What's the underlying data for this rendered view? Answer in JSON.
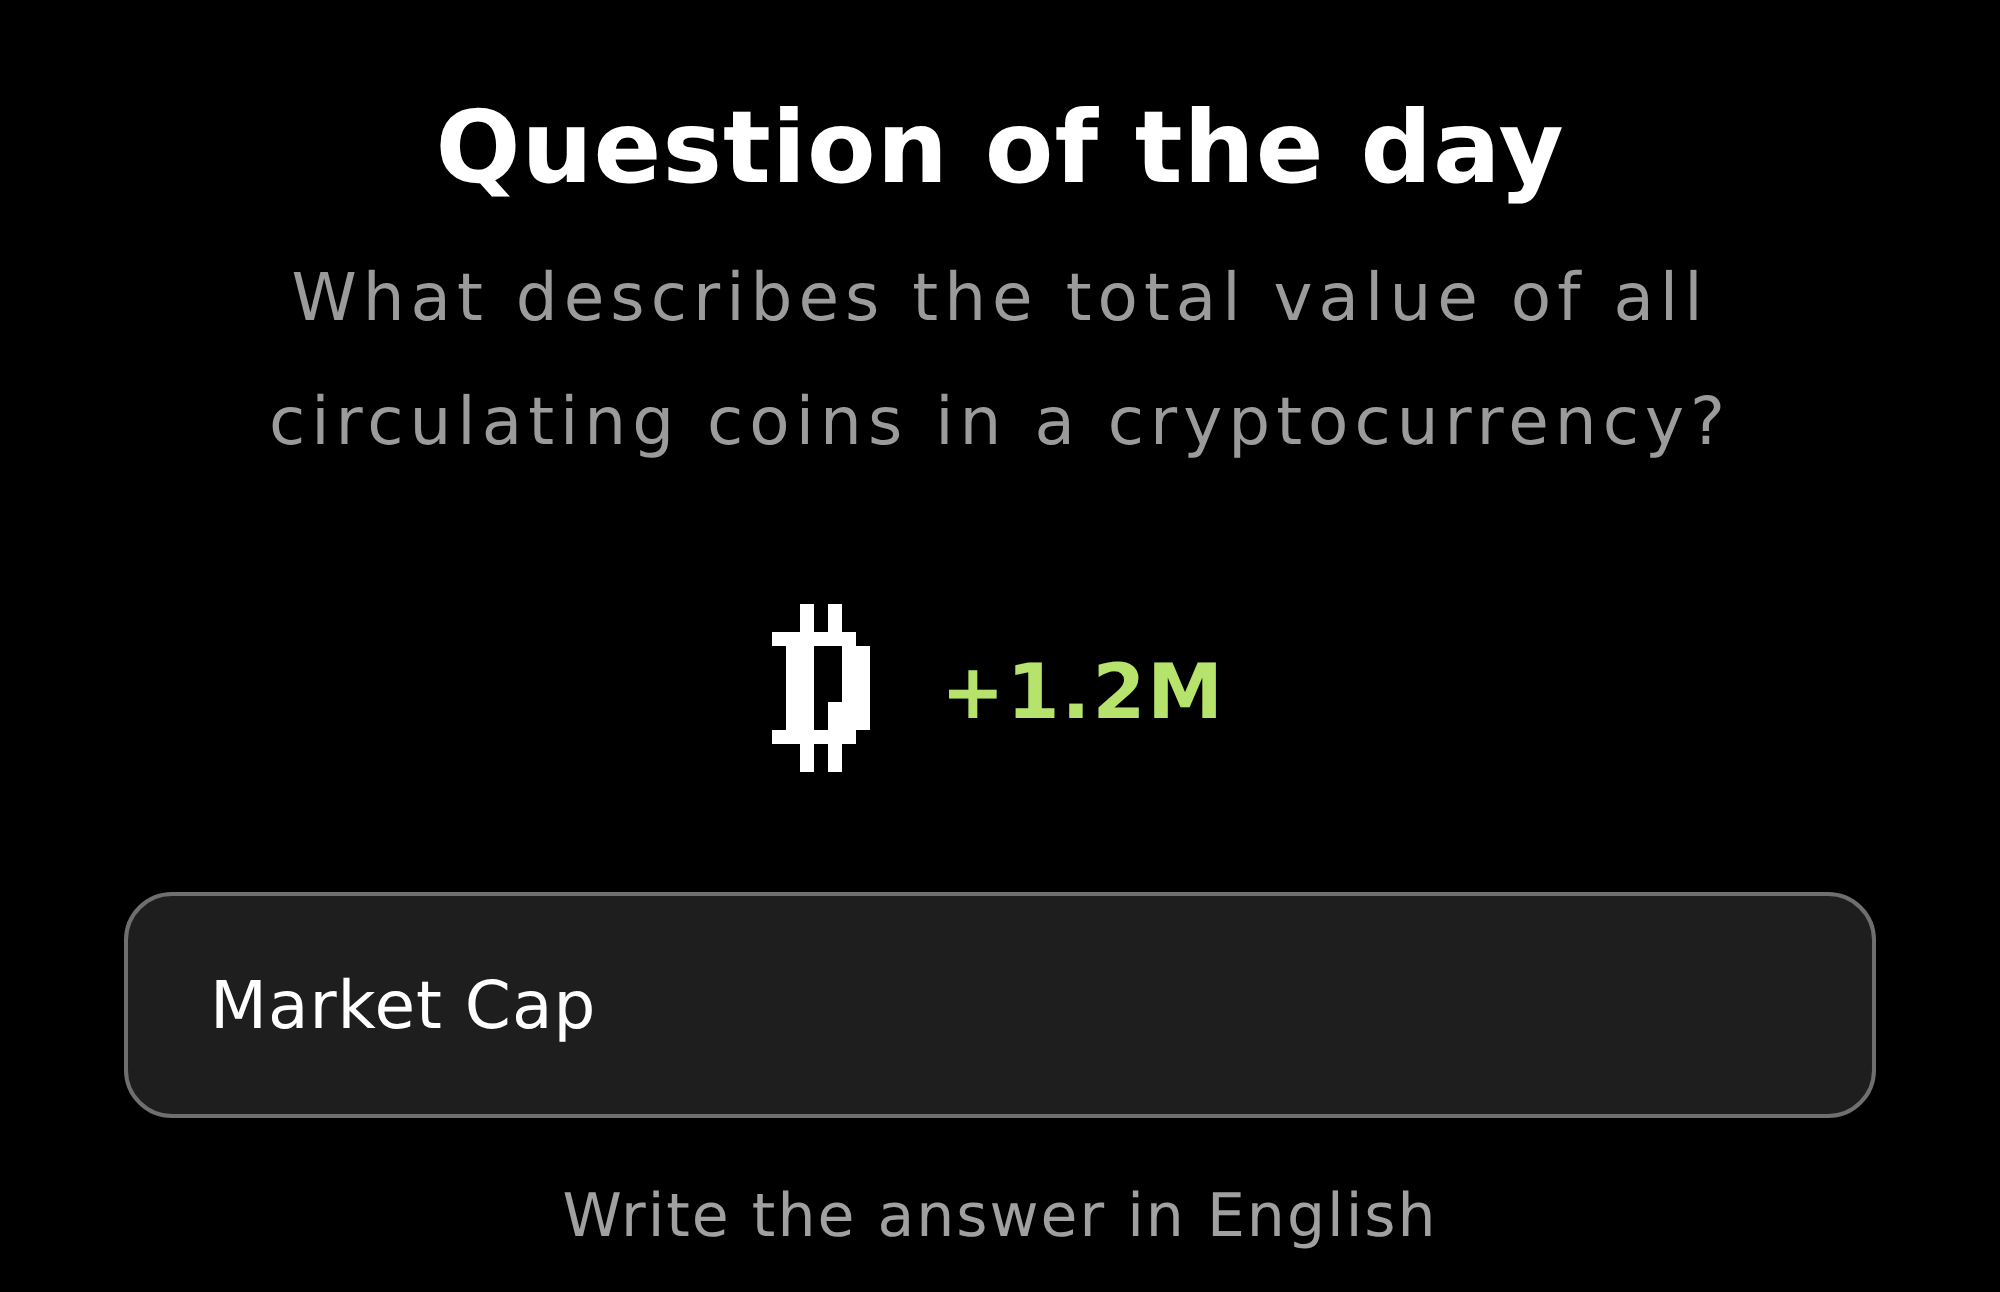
{
  "title": "Question of the day",
  "question": "What describes the total value of all circulating coins in a cryptocurrency?",
  "reward": {
    "amount": "+1.2M"
  },
  "answer_field": {
    "value": "Market Cap"
  },
  "hint": "Write the answer in English"
}
